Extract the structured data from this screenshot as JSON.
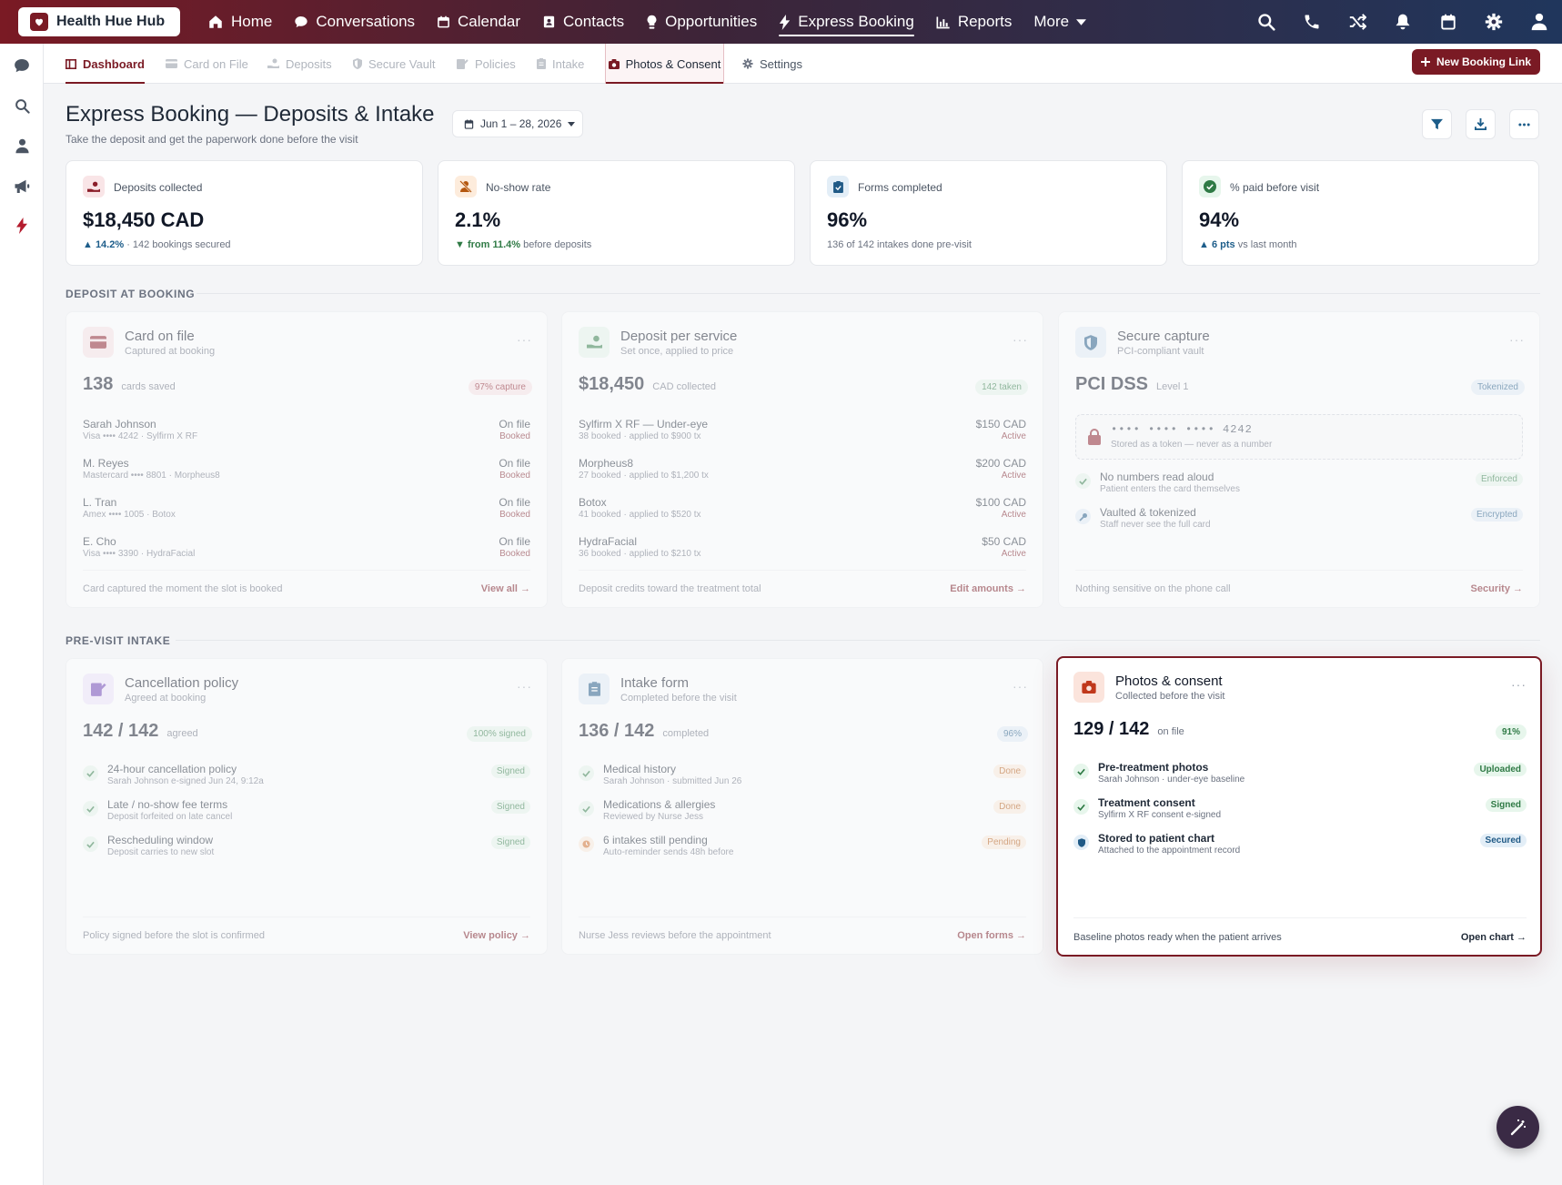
{
  "topnav": {
    "brand": "Health Hue Hub",
    "links": [
      "Home",
      "Conversations",
      "Calendar",
      "Contacts",
      "Opportunities",
      "Express Booking",
      "Reports",
      "More"
    ]
  },
  "tabs": [
    "Dashboard",
    "Card on File",
    "Deposits",
    "Secure Vault",
    "Policies",
    "Intake",
    "Photos & Consent",
    "Settings"
  ],
  "new_booking_label": "New Booking Link",
  "header": {
    "title": "Express Booking — Deposits & Intake",
    "subtitle": "Take the deposit and get the paperwork done before the visit",
    "date_range": "Jun 1 – 28, 2026"
  },
  "kpis": [
    {
      "label": "Deposits collected",
      "value": "$18,450 CAD",
      "delta": "▲ 14.2%",
      "note": "· 142 bookings secured",
      "delta_color": "#1d5d8a",
      "icon": "hand-coins-icon"
    },
    {
      "label": "No-show rate",
      "value": "2.1%",
      "delta": "▼ from 11.4%",
      "note": "before deposits",
      "delta_color": "#2f7a45",
      "icon": "person-off-icon"
    },
    {
      "label": "Forms completed",
      "value": "96%",
      "delta": "",
      "note": "136 of 142 intakes done pre-visit",
      "delta_color": "#1d5d8a",
      "icon": "clipboard-check-icon"
    },
    {
      "label": "% paid before visit",
      "value": "94%",
      "delta": "▲ 6 pts",
      "note": "vs last month",
      "delta_color": "#1d5d8a",
      "icon": "check-circle-icon"
    }
  ],
  "sections": {
    "deposit": "DEPOSIT AT BOOKING",
    "intake": "PRE-VISIT INTAKE"
  },
  "cards": {
    "card_on_file": {
      "title": "Card on file",
      "subtitle": "Captured at booking",
      "big": "138",
      "unit": "cards saved",
      "pill": "97% capture",
      "rows": [
        {
          "name": "Sarah Johnson",
          "detail": "Visa •••• 4242 · Sylfirm X RF",
          "status": "On file",
          "state": "Booked"
        },
        {
          "name": "M. Reyes",
          "detail": "Mastercard •••• 8801 · Morpheus8",
          "status": "On file",
          "state": "Booked"
        },
        {
          "name": "L. Tran",
          "detail": "Amex •••• 1005 · Botox",
          "status": "On file",
          "state": "Booked"
        },
        {
          "name": "E. Cho",
          "detail": "Visa •••• 3390 · HydraFacial",
          "status": "On file",
          "state": "Booked"
        }
      ],
      "footer": "Card captured the moment the slot is booked",
      "link": "View all →"
    },
    "deposit_per_service": {
      "title": "Deposit per service",
      "subtitle": "Set once, applied to price",
      "big": "$18,450",
      "unit": "CAD collected",
      "pill": "142 taken",
      "rows": [
        {
          "name": "Sylfirm X RF — Under-eye",
          "detail": "38 booked · applied to $900 tx",
          "status": "$150 CAD",
          "state": "Active"
        },
        {
          "name": "Morpheus8",
          "detail": "27 booked · applied to $1,200 tx",
          "status": "$200 CAD",
          "state": "Active"
        },
        {
          "name": "Botox",
          "detail": "41 booked · applied to $520 tx",
          "status": "$100 CAD",
          "state": "Active"
        },
        {
          "name": "HydraFacial",
          "detail": "36 booked · applied to $210 tx",
          "status": "$50 CAD",
          "state": "Active"
        }
      ],
      "footer": "Deposit credits toward the treatment total",
      "link": "Edit amounts →"
    },
    "secure_capture": {
      "title": "Secure capture",
      "subtitle": "PCI-compliant vault",
      "big": "PCI DSS",
      "unit": "Level 1",
      "pill": "Tokenized",
      "card_mask": "•••• •••• •••• 4242",
      "card_note": "Stored as a token — never as a number",
      "rows": [
        {
          "name": "No numbers read aloud",
          "detail": "Patient enters the card themselves",
          "badge": "Enforced"
        },
        {
          "name": "Vaulted & tokenized",
          "detail": "Staff never see the full card",
          "badge": "Encrypted"
        }
      ],
      "footer": "Nothing sensitive on the phone call",
      "link": "Security →"
    },
    "cancellation": {
      "title": "Cancellation policy",
      "subtitle": "Agreed at booking",
      "big": "142 / 142",
      "unit": "agreed",
      "pill": "100% signed",
      "rows": [
        {
          "name": "24-hour cancellation policy",
          "detail": "Sarah Johnson e-signed Jun 24, 9:12a",
          "badge": "Signed"
        },
        {
          "name": "Late / no-show fee terms",
          "detail": "Deposit forfeited on late cancel",
          "badge": "Signed"
        },
        {
          "name": "Rescheduling window",
          "detail": "Deposit carries to new slot",
          "badge": "Signed"
        }
      ],
      "footer": "Policy signed before the slot is confirmed",
      "link": "View policy →"
    },
    "intake_form": {
      "title": "Intake form",
      "subtitle": "Completed before the visit",
      "big": "136 / 142",
      "unit": "completed",
      "pill": "96%",
      "rows": [
        {
          "name": "Medical history",
          "detail": "Sarah Johnson · submitted Jun 26",
          "badge": "Done"
        },
        {
          "name": "Medications & allergies",
          "detail": "Reviewed by Nurse Jess",
          "badge": "Done"
        },
        {
          "name": "6 intakes still pending",
          "detail": "Auto-reminder sends 48h before",
          "badge": "Pending"
        }
      ],
      "footer": "Nurse Jess reviews before the appointment",
      "link": "Open forms →"
    },
    "photos_consent": {
      "title": "Photos & consent",
      "subtitle": "Collected before the visit",
      "big": "129 / 142",
      "unit": "on file",
      "pill": "91%",
      "rows": [
        {
          "name": "Pre-treatment photos",
          "detail": "Sarah Johnson · under-eye baseline",
          "badge": "Uploaded"
        },
        {
          "name": "Treatment consent",
          "detail": "Sylfirm X RF consent e-signed",
          "badge": "Signed"
        },
        {
          "name": "Stored to patient chart",
          "detail": "Attached to the appointment record",
          "badge": "Secured"
        }
      ],
      "footer": "Baseline photos ready when the patient arrives",
      "link": "Open chart →"
    }
  },
  "colors": {
    "brand": "#7a1a24",
    "nav_end": "#20365c",
    "accent_blue": "#1d5d8a",
    "success": "#2f7a45"
  }
}
